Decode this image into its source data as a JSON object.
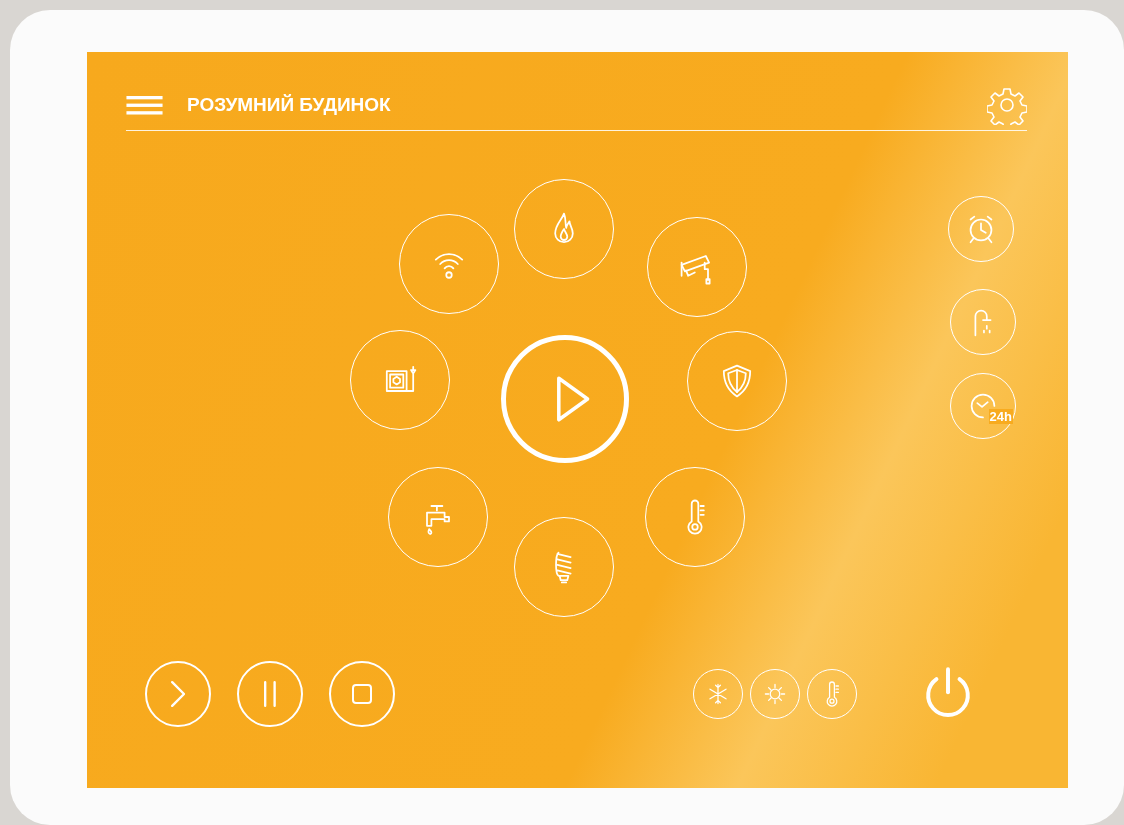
{
  "header": {
    "title": "РОЗУМНИЙ БУДИНОК"
  },
  "hub": {
    "center": {
      "kind": "play"
    },
    "ring": [
      {
        "kind": "flame"
      },
      {
        "kind": "wifi"
      },
      {
        "kind": "camera"
      },
      {
        "kind": "boiler"
      },
      {
        "kind": "shield"
      },
      {
        "kind": "tap"
      },
      {
        "kind": "thermometer"
      },
      {
        "kind": "bulb"
      }
    ]
  },
  "side_buttons": [
    {
      "kind": "alarm"
    },
    {
      "kind": "shower"
    },
    {
      "kind": "timer",
      "label": "24h"
    }
  ],
  "playback": [
    {
      "kind": "next"
    },
    {
      "kind": "pause"
    },
    {
      "kind": "stop"
    }
  ],
  "modes": [
    {
      "kind": "snow"
    },
    {
      "kind": "sun"
    },
    {
      "kind": "thermometer"
    }
  ],
  "power": {
    "kind": "power"
  }
}
